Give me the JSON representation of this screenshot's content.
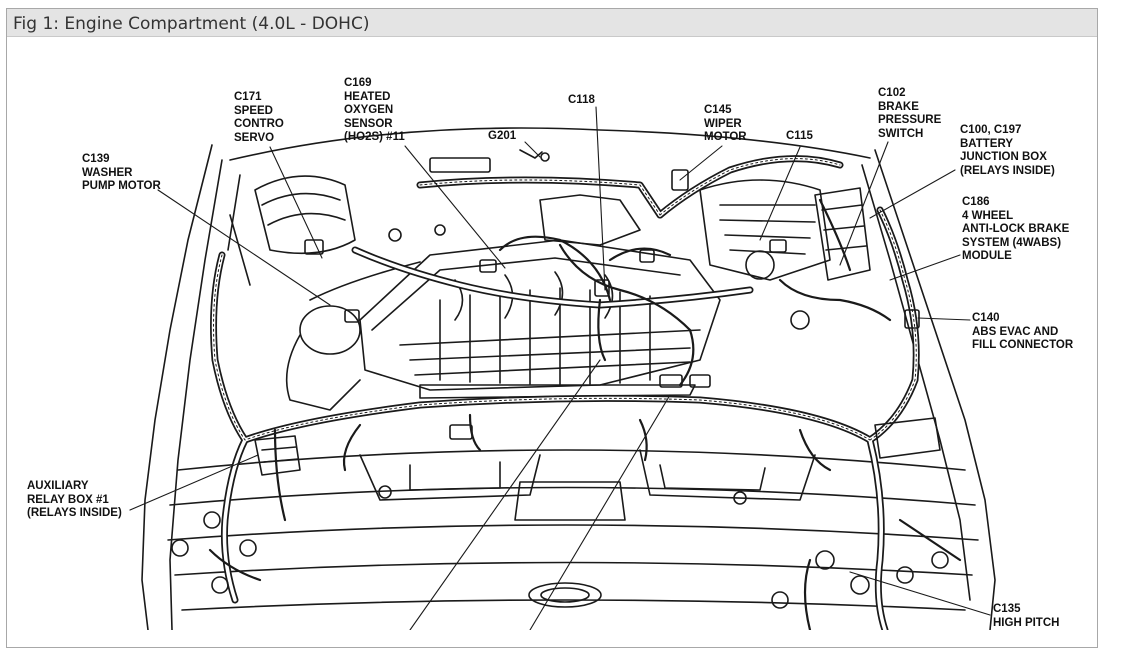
{
  "window": {
    "title": "Fig 1: Engine Compartment (4.0L - DOHC)"
  },
  "labels": {
    "c171": "C171\nSPEED\nCONTRO\nSERVO",
    "c169": "C169\nHEATED\nOXYGEN\nSENSOR\n(HO2S) #11",
    "c118": "C118",
    "g201": "G201",
    "c145": "C145\nWIPER\nMOTOR",
    "c115": "C115",
    "c102": "C102\nBRAKE\nPRESSURE\nSWITCH",
    "c100": "C100, C197\nBATTERY\nJUNCTION BOX\n(RELAYS INSIDE)",
    "c139": "C139\nWASHER\nPUMP MOTOR",
    "c186": "C186\n4 WHEEL\nANTI-LOCK BRAKE\nSYSTEM (4WABS)\nMODULE",
    "c140": "C140\nABS EVAC AND\nFILL CONNECTOR",
    "aux": "AUXILIARY\nRELAY BOX #1\n(RELAYS INSIDE)",
    "c135": "C135\nHIGH PITCH"
  },
  "colors": {
    "line": "#1a1a1a",
    "titlebar": "#e4e4e4",
    "border": "#a8a8a8"
  }
}
